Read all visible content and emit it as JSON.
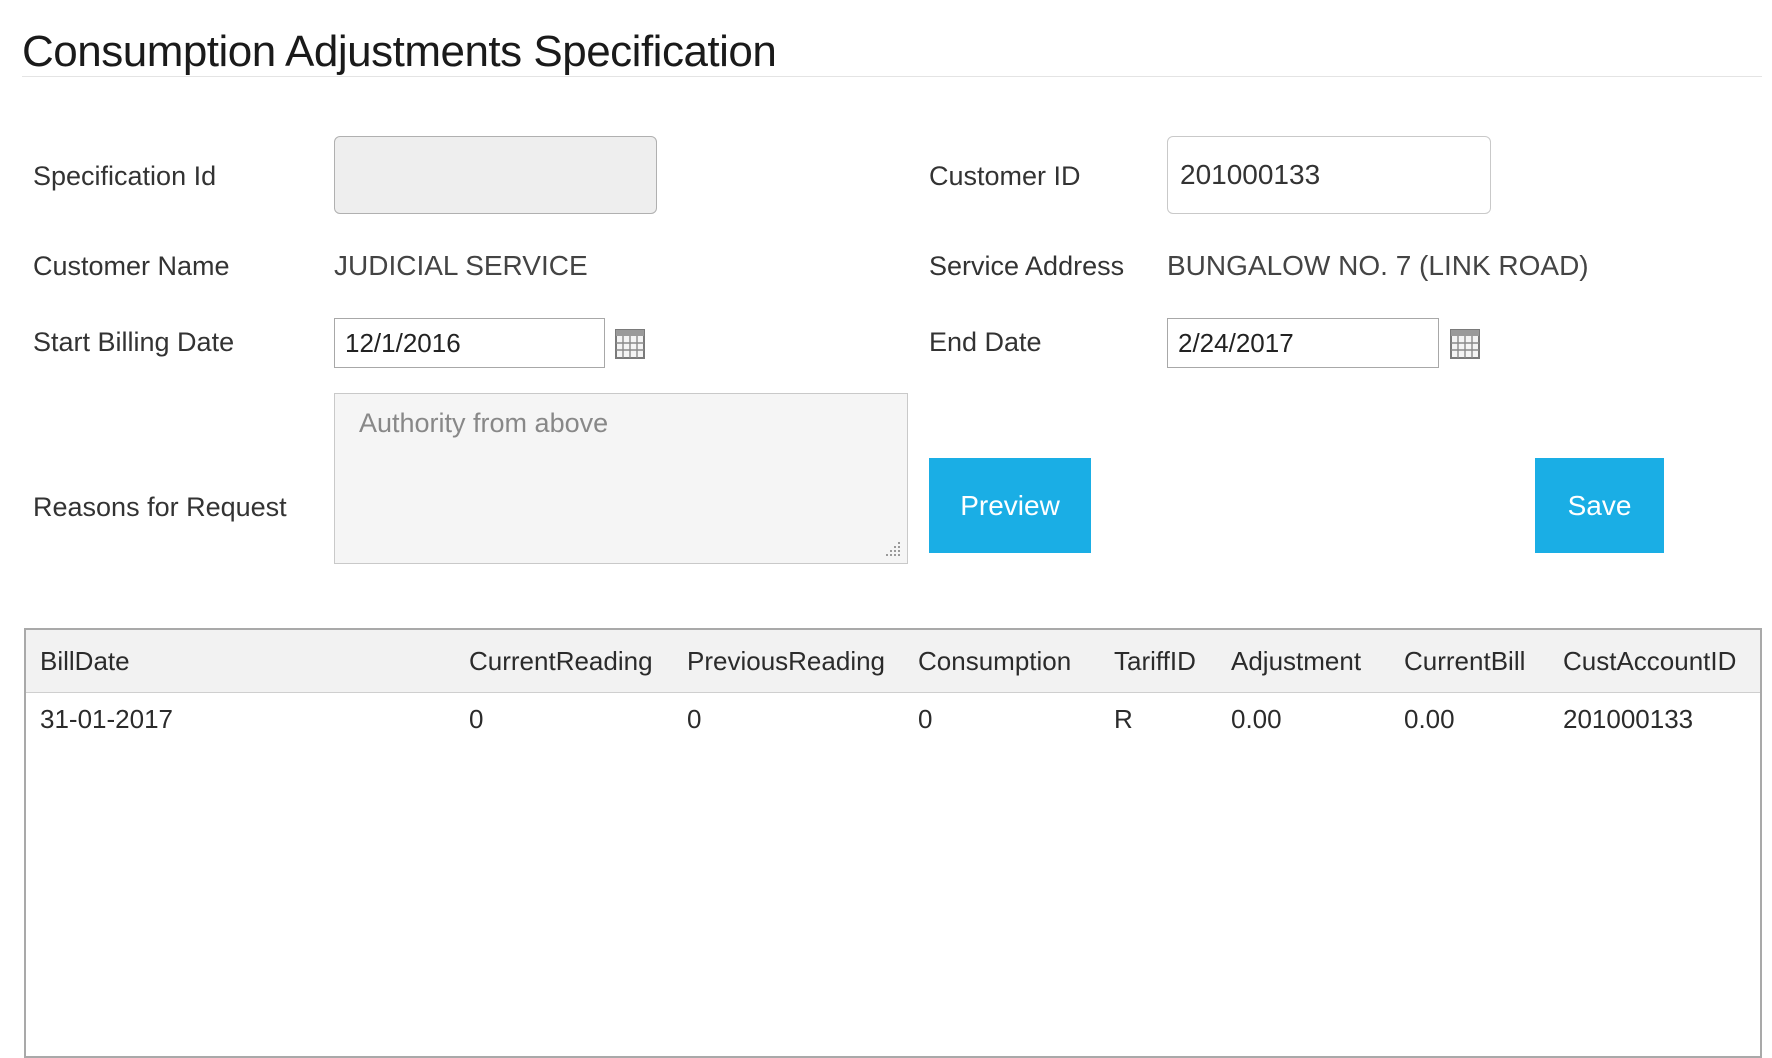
{
  "page": {
    "title": "Consumption Adjustments Specification"
  },
  "form": {
    "specification_id": {
      "label": "Specification Id",
      "value": ""
    },
    "customer_id": {
      "label": "Customer ID",
      "value": "201000133"
    },
    "customer_name": {
      "label": "Customer Name",
      "value": "JUDICIAL SERVICE"
    },
    "service_address": {
      "label": "Service Address",
      "value": "BUNGALOW NO. 7 (LINK ROAD)"
    },
    "start_billing_date": {
      "label": "Start Billing Date",
      "value": "12/1/2016",
      "icon": "calendar-icon"
    },
    "end_date": {
      "label": "End Date",
      "value": "2/24/2017",
      "icon": "calendar-icon"
    },
    "reasons": {
      "label": "Reasons for Request",
      "value": "Authority from above"
    }
  },
  "actions": {
    "preview_label": "Preview",
    "save_label": "Save",
    "accent_color": "#1aaee5"
  },
  "grid": {
    "columns": [
      "BillDate",
      "CurrentReading",
      "PreviousReading",
      "Consumption",
      "TariffID",
      "Adjustment",
      "CurrentBill",
      "CustAccountID"
    ],
    "rows": [
      [
        "31-01-2017",
        "0",
        "0",
        "0",
        "R",
        "0.00",
        "0.00",
        "201000133"
      ]
    ]
  }
}
